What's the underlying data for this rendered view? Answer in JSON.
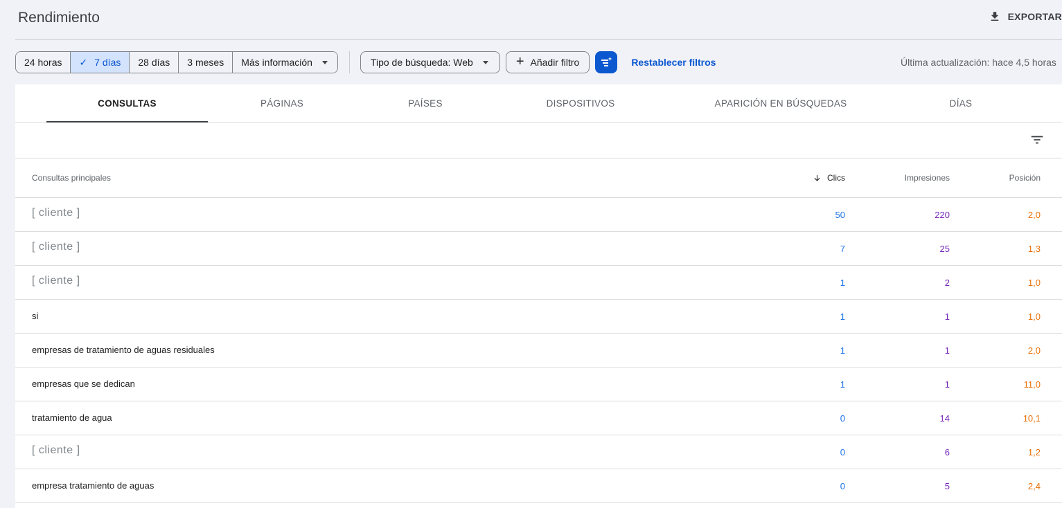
{
  "header": {
    "title": "Rendimiento",
    "export_label": "EXPORTAR"
  },
  "filters": {
    "date_ranges": [
      "24 horas",
      "7 días",
      "28 días",
      "3 meses"
    ],
    "selected_range": "7 días",
    "more_label": "Más información",
    "search_type_label": "Tipo de búsqueda: Web",
    "add_filter_label": "Añadir filtro",
    "reset_label": "Restablecer filtros",
    "last_updated": "Última actualización: hace 4,5 horas"
  },
  "tabs": [
    "CONSULTAS",
    "PÁGINAS",
    "PAÍSES",
    "DISPOSITIVOS",
    "APARICIÓN EN BÚSQUEDAS",
    "DÍAS"
  ],
  "active_tab": "CONSULTAS",
  "table": {
    "headers": {
      "query": "Consultas principales",
      "clicks": "Clics",
      "impressions": "Impresiones",
      "position": "Posición"
    },
    "sorted_by": "Clics",
    "rows": [
      {
        "query": "[ cliente ]",
        "clicks": "50",
        "impressions": "220",
        "position": "2,0"
      },
      {
        "query": "[ cliente ]",
        "clicks": "7",
        "impressions": "25",
        "position": "1,3"
      },
      {
        "query": "[ cliente ]",
        "clicks": "1",
        "impressions": "2",
        "position": "1,0"
      },
      {
        "query": "si",
        "clicks": "1",
        "impressions": "1",
        "position": "1,0"
      },
      {
        "query": "empresas de tratamiento de aguas residuales",
        "clicks": "1",
        "impressions": "1",
        "position": "2,0"
      },
      {
        "query": "empresas que se dedican",
        "clicks": "1",
        "impressions": "1",
        "position": "11,0"
      },
      {
        "query": "tratamiento de agua",
        "clicks": "0",
        "impressions": "14",
        "position": "10,1"
      },
      {
        "query": "[ cliente ]",
        "clicks": "0",
        "impressions": "6",
        "position": "1,2"
      },
      {
        "query": "empresa tratamiento de aguas",
        "clicks": "0",
        "impressions": "5",
        "position": "2,4"
      }
    ]
  },
  "colors": {
    "accent": "#0b57d0",
    "clicks": "#1a73e8",
    "impressions": "#7627bb",
    "position": "#e8710a"
  }
}
